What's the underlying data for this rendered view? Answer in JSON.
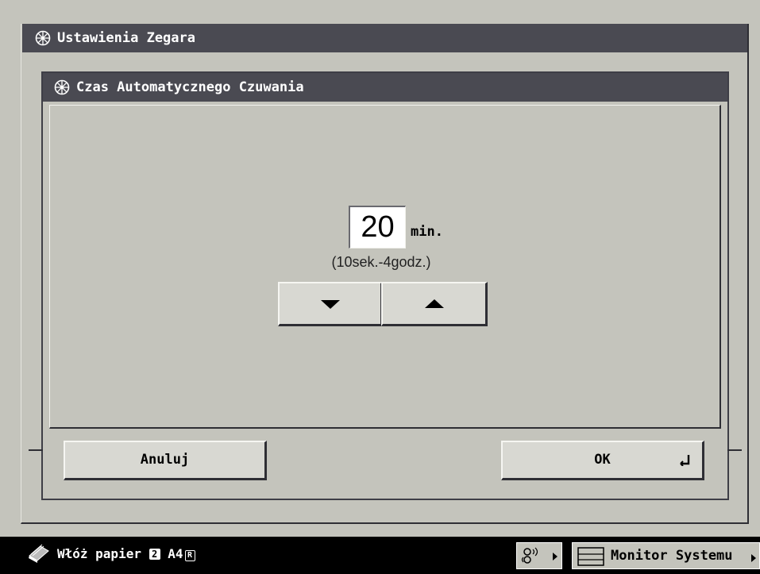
{
  "window": {
    "title": "Ustawienia Zegara",
    "icon": "settings-wheel-icon"
  },
  "dialog": {
    "title": "Czas Automatycznego Czuwania",
    "icon": "settings-wheel-icon",
    "value": "20",
    "unit": "min.",
    "range": "(10sek.-4godz.)",
    "decrease_icon": "arrow-down-icon",
    "increase_icon": "arrow-up-icon",
    "cancel_label": "Anuluj",
    "ok_label": "OK",
    "ok_icon": "enter-icon"
  },
  "status_bar": {
    "message": "Włóż papier",
    "tray_number": "2",
    "paper_size": "A4",
    "orientation_mark": "R",
    "network_icon": "network-status-icon",
    "monitor_label": "Monitor Systemu",
    "monitor_icon": "system-monitor-icon"
  },
  "colors": {
    "background": "#c4c4bc",
    "titlebar": "#4a4a52",
    "status_bar": "#000000"
  }
}
